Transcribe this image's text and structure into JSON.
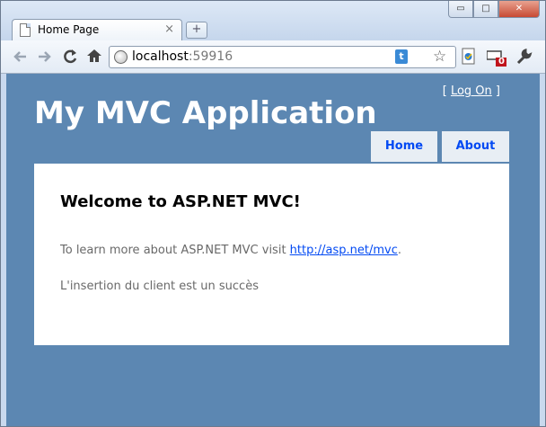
{
  "browser": {
    "tab_title": "Home Page",
    "tab_close": "×",
    "new_tab": "+",
    "window_buttons": {
      "minimize": "▭",
      "maximize": "□",
      "close": "✕"
    },
    "url_host": "localhost",
    "url_port": ":59916",
    "toolbar_icons": [
      "back-icon",
      "forward-icon",
      "reload-icon",
      "home-icon",
      "globe-icon",
      "twitter-icon",
      "star-icon",
      "page-icon",
      "counter-extension-icon",
      "wrench-icon"
    ],
    "badge_count": "0"
  },
  "site": {
    "login_open": "[",
    "login_link": "Log On",
    "login_close": "]",
    "title": "My MVC Application",
    "menu": [
      "Home",
      "About"
    ],
    "heading": "Welcome to ASP.NET MVC!",
    "paragraph_prefix": "To learn more about ASP.NET MVC visit ",
    "paragraph_link": "http://asp.net/mvc",
    "paragraph_suffix": ".",
    "message": "L'insertion du client est un succès"
  },
  "colors": {
    "page_background": "#5c87b2",
    "menu_tab": "#e8eef4",
    "link": "#034af3",
    "body_text": "#696969"
  }
}
